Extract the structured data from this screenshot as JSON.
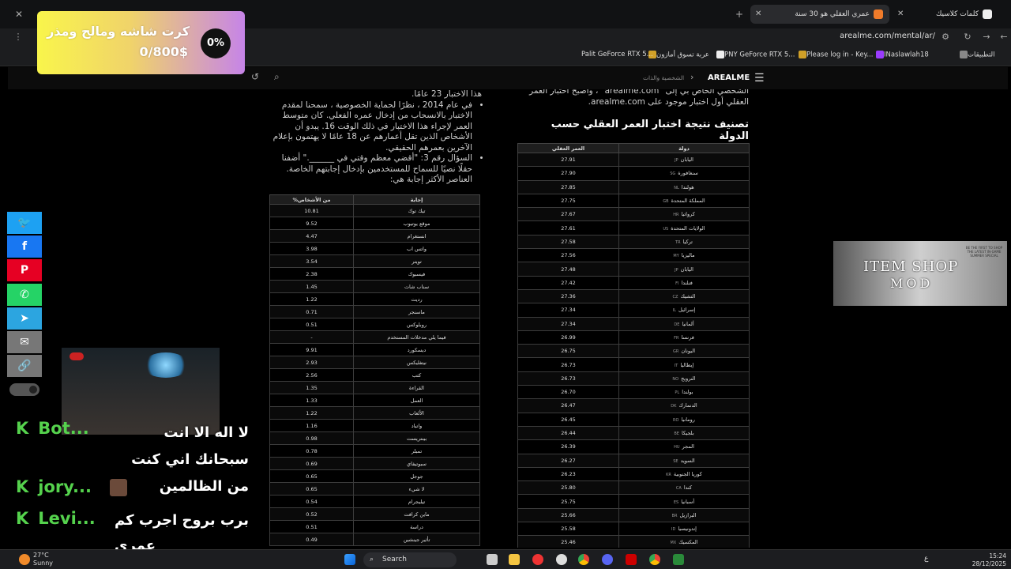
{
  "browser": {
    "tabs": [
      {
        "title": "كلمات كلاسيك",
        "active": false
      },
      {
        "title": "عمري العقلي هو 30 سنة",
        "active": true
      }
    ],
    "new_tab": "+",
    "url": "arealme.com/mental/ar/",
    "bookmarks": [
      "التطبيقات",
      "INaslawlah18",
      "Please log in - Key...",
      "PNY GeForce RTX 5...",
      "عربة تسوق أمازون",
      "Palit GeForce RTX 5..."
    ]
  },
  "site": {
    "logo": "AREALME",
    "breadcrumb": "الشخصية والذات"
  },
  "article": {
    "left_intro": "هذا الاختبار 23 عامًا.",
    "bullet1": "في عام 2014 ، نظرًا لحماية الخصوصية ، سمحنا لمقدم الاختبار بالانسحاب من إدخال عمره الفعلي. كان متوسط العمر لإجراء هذا الاختبار في ذلك الوقت 16. يبدو أن الأشخاص الذين تقل أعمارهم عن 18 عامًا لا يهتمون بإعلام الآخرين بعمرهم الحقيقي.",
    "bullet2": "السؤال رقم 3: \"أقضي معظم وقتي في ______.\" أضفنا حقلًا نصيًا للسماح للمستخدمين بإدخال إجابتهم الخاصة. العناصر الأكثر إجابة هي:",
    "right_intro": "الشخصي الخاص بي إلى \"arealme.com\" ، وأصبح اختبار العمر العقلي أول اختبار موجود على arealme.com.",
    "heading": "تصنيف نتيجة اختبار العمر العقلي حسب الدولة"
  },
  "answers_table": {
    "headers": [
      "إجابة",
      "%من الأشخاص"
    ],
    "rows": [
      [
        "تيك توك",
        "10.81"
      ],
      [
        "موقع يوتيوب",
        "9.52"
      ],
      [
        "انستغرام",
        "4.47"
      ],
      [
        "واتس اب",
        "3.98"
      ],
      [
        "تويتر",
        "3.54"
      ],
      [
        "فيسبوك",
        "2.38"
      ],
      [
        "سناب شات",
        "1.45"
      ],
      [
        "رديت",
        "1.22"
      ],
      [
        "ماسنجر",
        "0.71"
      ],
      [
        "روبلوكس",
        "0.51"
      ],
      [
        "فيما يلي مدخلات المستخدم",
        "-"
      ],
      [
        "ديسكورد",
        "9.91"
      ],
      [
        "نيتفليكس",
        "2.93"
      ],
      [
        "كتب",
        "2.56"
      ],
      [
        "القراءة",
        "1.35"
      ],
      [
        "العمل",
        "1.33"
      ],
      [
        "الألعاب",
        "1.22"
      ],
      [
        "واتباد",
        "1.16"
      ],
      [
        "بينتريست",
        "0.98"
      ],
      [
        "تمبلر",
        "0.78"
      ],
      [
        "سبوتيفاي",
        "0.69"
      ],
      [
        "جوجل",
        "0.65"
      ],
      [
        "لا شيء",
        "0.65"
      ],
      [
        "تيليجرام",
        "0.54"
      ],
      [
        "ماين كرافت",
        "0.52"
      ],
      [
        "دراسة",
        "0.51"
      ],
      [
        "تأثير جينشين",
        "0.49"
      ]
    ]
  },
  "country_table": {
    "headers": [
      "دولة",
      "العمر العقلي"
    ],
    "rows": [
      [
        "اليابان",
        "JP",
        "27.91"
      ],
      [
        "سنغافورة",
        "SG",
        "27.90"
      ],
      [
        "هولندا",
        "NL",
        "27.85"
      ],
      [
        "المملكة المتحدة",
        "GB",
        "27.75"
      ],
      [
        "كرواتيا",
        "HR",
        "27.67"
      ],
      [
        "الولايات المتحدة",
        "US",
        "27.61"
      ],
      [
        "تركيا",
        "TR",
        "27.58"
      ],
      [
        "ماليزيا",
        "MY",
        "27.56"
      ],
      [
        "اليابان",
        "JP",
        "27.48"
      ],
      [
        "فنلندا",
        "FI",
        "27.42"
      ],
      [
        "التشيك",
        "CZ",
        "27.36"
      ],
      [
        "إسرائيل",
        "IL",
        "27.34"
      ],
      [
        "ألمانيا",
        "DE",
        "27.34"
      ],
      [
        "فرنسا",
        "FR",
        "26.99"
      ],
      [
        "اليونان",
        "GR",
        "26.75"
      ],
      [
        "إيطاليا",
        "IT",
        "26.73"
      ],
      [
        "النرويج",
        "NO",
        "26.73"
      ],
      [
        "بولندا",
        "PL",
        "26.70"
      ],
      [
        "الدنمارك",
        "DK",
        "26.47"
      ],
      [
        "رومانيا",
        "RO",
        "26.45"
      ],
      [
        "بلجيكا",
        "BE",
        "26.44"
      ],
      [
        "المجر",
        "HU",
        "26.39"
      ],
      [
        "السويد",
        "SE",
        "26.27"
      ],
      [
        "كوريا الجنوبية",
        "KR",
        "26.23"
      ],
      [
        "كندا",
        "CA",
        "25.80"
      ],
      [
        "أسبانيا",
        "ES",
        "25.75"
      ],
      [
        "البرازيل",
        "BR",
        "25.66"
      ],
      [
        "إندونيسيا",
        "ID",
        "25.58"
      ],
      [
        "المكسيك",
        "MX",
        "25.46"
      ]
    ]
  },
  "overlay": {
    "goal_title": "كرت شاشه ومالح ومذر",
    "goal_amount": "0/800$",
    "goal_percent": "0%",
    "goal_progress": 0,
    "item_shop_line1": "ITEM SHOP",
    "item_shop_line2": "MOD",
    "item_shop_note": "BE THE FIRST TO SHOP THE LATEST IN-GAME SUMMER SPECIAL"
  },
  "chat": [
    {
      "user": "Bot...",
      "message": "لا اله الا انت سبحانك اني كنت من الظالمين"
    },
    {
      "user": "jory...",
      "message": ""
    },
    {
      "user": "Levi...",
      "message": "برب بروح اجرب كم عمري"
    }
  ],
  "taskbar": {
    "temp": "27°C",
    "weather": "Sunny",
    "search": "Search",
    "time": "15:24",
    "date": "28/12/2025",
    "lang": "ع"
  },
  "colors": {
    "chat_green": "#55d24d",
    "goal_start": "#f9f54b",
    "goal_end": "#c684e8"
  },
  "icons": [
    "twitter-icon",
    "facebook-icon",
    "pinterest-icon",
    "whatsapp-icon",
    "telegram-icon",
    "email-icon",
    "link-icon",
    "windows-icon",
    "search-icon"
  ]
}
